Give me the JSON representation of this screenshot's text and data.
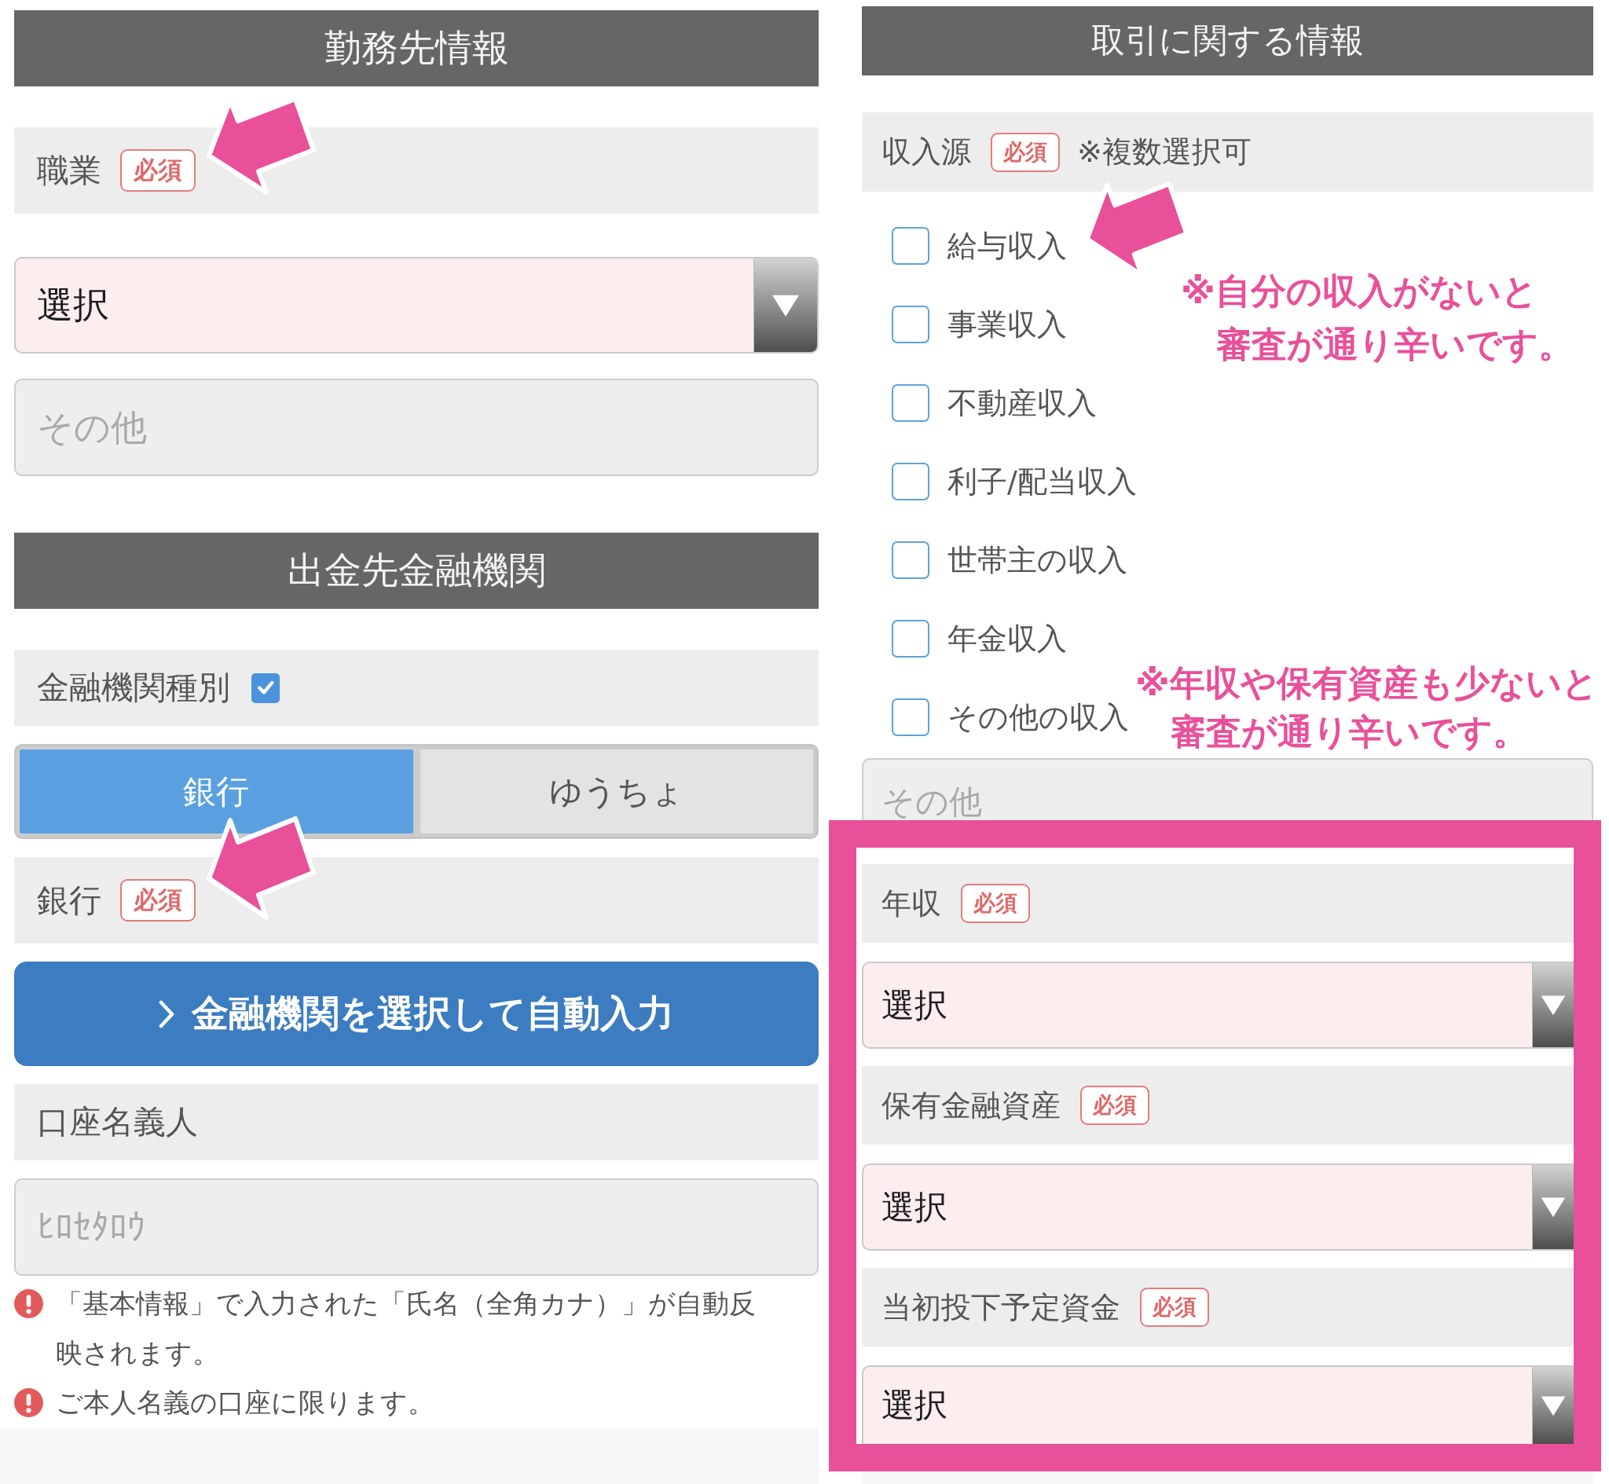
{
  "left_panel": {
    "sections": [
      {
        "title": "勤務先情報",
        "items": [
          {
            "kind": "label",
            "text": "職業",
            "badge": "必須"
          },
          {
            "kind": "select",
            "value": "選択"
          },
          {
            "kind": "input",
            "placeholder": "その他"
          }
        ]
      },
      {
        "title": "出金先金融機関",
        "items": [
          {
            "kind": "label",
            "text": "金融機関種別",
            "checked": true
          },
          {
            "kind": "tabs",
            "tabs": [
              {
                "label": "銀行",
                "selected": true
              },
              {
                "label": "ゆうちょ",
                "selected": false
              }
            ]
          },
          {
            "kind": "label",
            "text": "銀行",
            "badge": "必須"
          },
          {
            "kind": "button",
            "label": "金融機関を選択して自動入力"
          },
          {
            "kind": "label",
            "text": "口座名義人"
          },
          {
            "kind": "input",
            "placeholder": "ﾋﾛｾﾀﾛｳ"
          },
          {
            "kind": "notes",
            "notes": [
              "「基本情報」で入力された「氏名（全角カナ）」が自動反映されます。",
              "ご本人名義の口座に限ります。"
            ]
          }
        ]
      }
    ]
  },
  "right_panel": {
    "sections": [
      {
        "title": "取引に関する情報",
        "items": [
          {
            "kind": "label",
            "text": "収入源",
            "badge": "必須",
            "hint": "※複数選択可"
          },
          {
            "kind": "checkboxes",
            "options": [
              {
                "label": "給与収入",
                "checked": false
              },
              {
                "label": "事業収入",
                "checked": false
              },
              {
                "label": "不動産収入",
                "checked": false
              },
              {
                "label": "利子/配当収入",
                "checked": false
              },
              {
                "label": "世帯主の収入",
                "checked": false
              },
              {
                "label": "年金収入",
                "checked": false
              },
              {
                "label": "その他の収入",
                "checked": false
              }
            ]
          },
          {
            "kind": "input",
            "placeholder": "その他"
          }
        ]
      }
    ],
    "highlight_box": {
      "items": [
        {
          "kind": "label",
          "text": "年収",
          "badge": "必須"
        },
        {
          "kind": "select",
          "value": "選択"
        },
        {
          "kind": "label",
          "text": "保有金融資産",
          "badge": "必須"
        },
        {
          "kind": "select",
          "value": "選択"
        },
        {
          "kind": "label",
          "text": "当初投下予定資金",
          "badge": "必須"
        },
        {
          "kind": "select",
          "value": "選択"
        }
      ]
    }
  },
  "annotations": [
    {
      "lines": [
        "※自分の収入がないと",
        "審査が通り辛いです。"
      ]
    },
    {
      "lines": [
        "※年収や保有資産も少ないと",
        "審査が通り辛いです。"
      ]
    }
  ]
}
